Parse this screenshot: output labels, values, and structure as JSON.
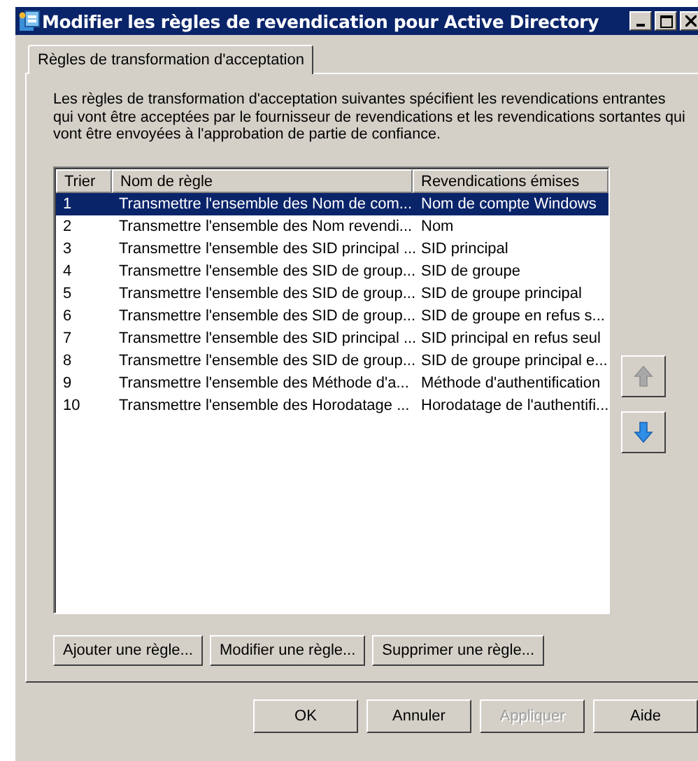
{
  "window": {
    "title": "Modifier les règles de revendication pour Active Directory"
  },
  "tabs": [
    {
      "label": "Règles de transformation d'acceptation",
      "selected": true
    }
  ],
  "description": "Les règles de transformation d'acceptation suivantes spécifient les revendications entrantes qui vont être acceptées par le fournisseur de revendications et les revendications sortantes qui vont être envoyées à l'approbation de partie de confiance.",
  "table": {
    "columns": [
      "Trier",
      "Nom de règle",
      "Revendications émises"
    ],
    "rows": [
      {
        "order": "1",
        "name": "Transmettre l'ensemble des Nom de com...",
        "claims": "Nom de compte Windows",
        "selected": true
      },
      {
        "order": "2",
        "name": "Transmettre l'ensemble des Nom revendi...",
        "claims": "Nom",
        "selected": false
      },
      {
        "order": "3",
        "name": "Transmettre l'ensemble des SID principal ...",
        "claims": "SID principal",
        "selected": false
      },
      {
        "order": "4",
        "name": "Transmettre l'ensemble des SID de group...",
        "claims": "SID de groupe",
        "selected": false
      },
      {
        "order": "5",
        "name": "Transmettre l'ensemble des SID de group...",
        "claims": "SID de groupe principal",
        "selected": false
      },
      {
        "order": "6",
        "name": "Transmettre l'ensemble des SID de group...",
        "claims": "SID de groupe en refus s...",
        "selected": false
      },
      {
        "order": "7",
        "name": "Transmettre l'ensemble des SID principal ...",
        "claims": "SID principal en refus seul",
        "selected": false
      },
      {
        "order": "8",
        "name": "Transmettre l'ensemble des SID de group...",
        "claims": "SID de groupe principal e...",
        "selected": false
      },
      {
        "order": "9",
        "name": "Transmettre l'ensemble des Méthode d'a...",
        "claims": "Méthode d'authentification",
        "selected": false
      },
      {
        "order": "10",
        "name": "Transmettre l'ensemble des Horodatage ...",
        "claims": "Horodatage de l'authentifi...",
        "selected": false
      }
    ]
  },
  "move_buttons": {
    "up_disabled": true,
    "down_disabled": false
  },
  "rule_buttons": [
    {
      "label": "Ajouter une règle..."
    },
    {
      "label": "Modifier une règle..."
    },
    {
      "label": "Supprimer une règle..."
    }
  ],
  "dialog_buttons": [
    {
      "label": "OK",
      "disabled": false
    },
    {
      "label": "Annuler",
      "disabled": false
    },
    {
      "label": "Appliquer",
      "disabled": true
    },
    {
      "label": "Aide",
      "disabled": false
    }
  ]
}
